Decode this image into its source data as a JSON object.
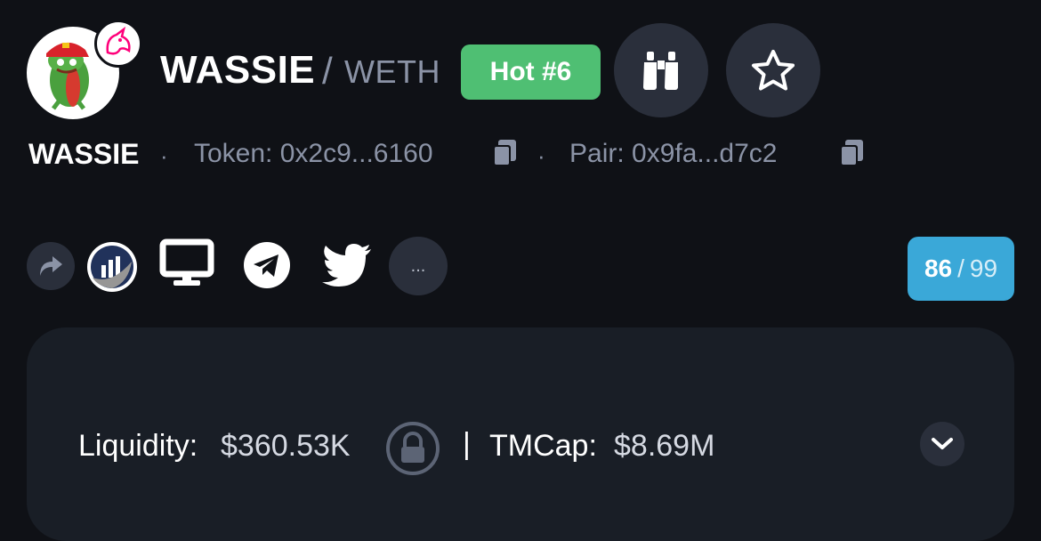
{
  "header": {
    "base_symbol": "WASSIE",
    "separator": "/",
    "quote_symbol": "WETH",
    "hot_badge": "Hot #6",
    "watch_icon": "binoculars-icon",
    "favorite_icon": "star-icon",
    "avatar_icon": "frog-token-icon",
    "dex_icon": "unicorn-icon"
  },
  "sub": {
    "name": "WASSIE",
    "token_label": "Token: 0x2c9...6160",
    "pair_label": "Pair: 0x9fa...d7c2",
    "copy_icon": "copy-icon"
  },
  "social": {
    "share_icon": "share-icon",
    "etherscan_icon": "etherscan-icon",
    "website_icon": "monitor-icon",
    "telegram_icon": "telegram-icon",
    "twitter_icon": "twitter-icon",
    "more_label": "..."
  },
  "score": {
    "value": "86",
    "separator": "/",
    "total": "99"
  },
  "metrics": {
    "liquidity_label": "Liquidity:",
    "liquidity_value": "$360.53K",
    "lock_icon": "lock-icon",
    "divider": "|",
    "tmcap_label": "TMCap:",
    "tmcap_value": "$8.69M",
    "expand_icon": "chevron-down-icon"
  },
  "colors": {
    "background": "#0f1116",
    "card": "#191e26",
    "hot_badge": "#4fbf73",
    "score_badge": "#3aa8d8",
    "muted_text": "#8b93a6"
  }
}
